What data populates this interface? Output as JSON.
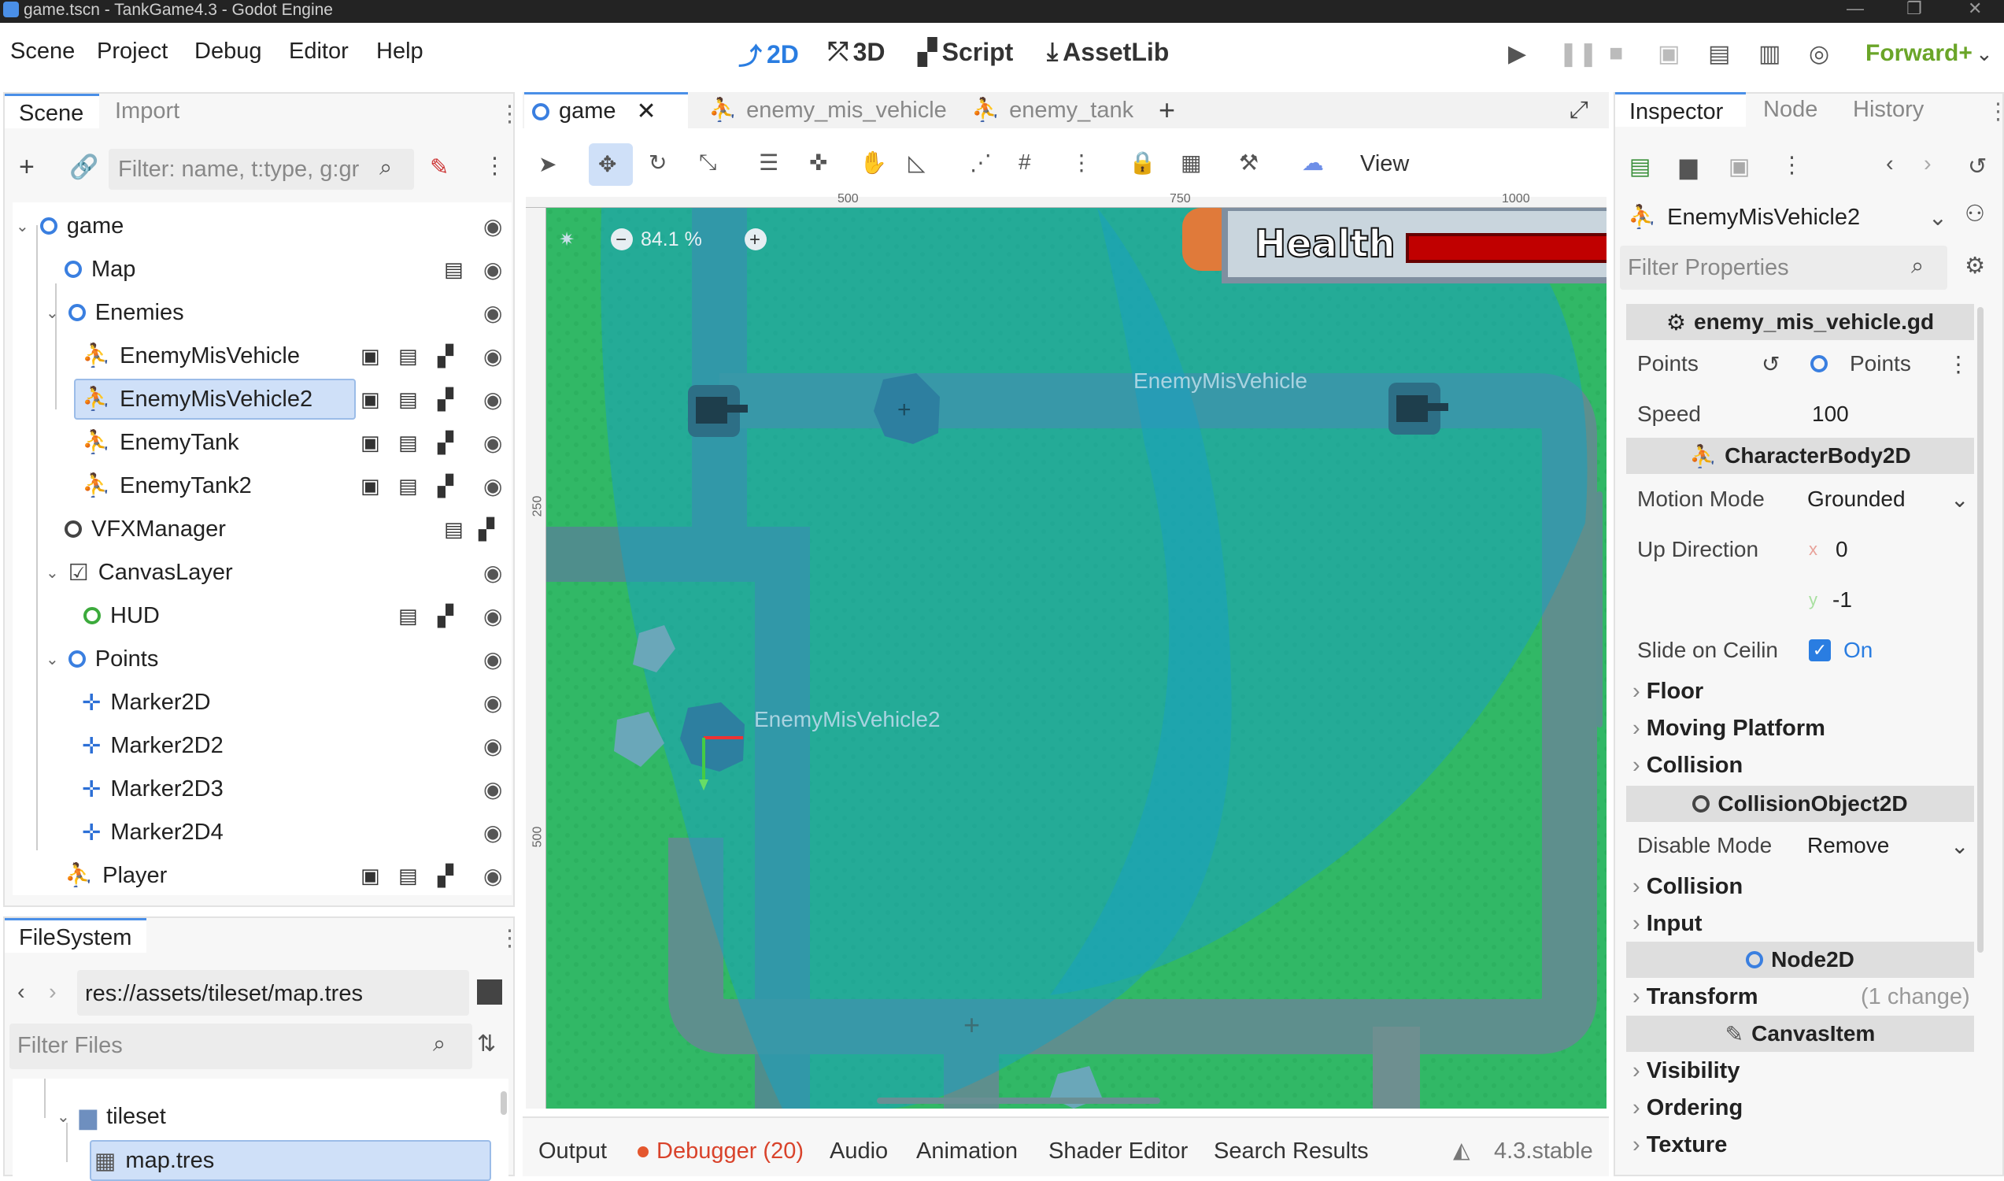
{
  "window": {
    "title": "game.tscn - TankGame4.3 - Godot Engine"
  },
  "menu": {
    "items": [
      "Scene",
      "Project",
      "Debug",
      "Editor",
      "Help"
    ]
  },
  "workspaces": {
    "2d": "2D",
    "3d": "3D",
    "script": "Script",
    "assetlib": "AssetLib"
  },
  "renderer": "Forward+",
  "scene_dock": {
    "tabs": [
      "Scene",
      "Import"
    ],
    "filter_placeholder": "Filter: name, t:type, g:gr",
    "tree": [
      {
        "label": "game"
      },
      {
        "label": "Map"
      },
      {
        "label": "Enemies"
      },
      {
        "label": "EnemyMisVehicle"
      },
      {
        "label": "EnemyMisVehicle2"
      },
      {
        "label": "EnemyTank"
      },
      {
        "label": "EnemyTank2"
      },
      {
        "label": "VFXManager"
      },
      {
        "label": "CanvasLayer"
      },
      {
        "label": "HUD"
      },
      {
        "label": "Points"
      },
      {
        "label": "Marker2D"
      },
      {
        "label": "Marker2D2"
      },
      {
        "label": "Marker2D3"
      },
      {
        "label": "Marker2D4"
      },
      {
        "label": "Player"
      }
    ]
  },
  "filesystem": {
    "tab": "FileSystem",
    "path": "res://assets/tileset/map.tres",
    "filter_placeholder": "Filter Files",
    "items": [
      {
        "label": "tileset"
      },
      {
        "label": "map.tres"
      }
    ]
  },
  "editor_tabs": [
    {
      "label": "game"
    },
    {
      "label": "enemy_mis_vehicle"
    },
    {
      "label": "enemy_tank"
    }
  ],
  "viewport": {
    "zoom": "84.1 %",
    "view_menu": "View",
    "ruler_ticks": [
      "500",
      "750",
      "1000"
    ],
    "ruler_vticks": [
      "250",
      "500"
    ],
    "labels": {
      "mis1": "EnemyMisVehicle",
      "mis2": "EnemyMisVehicle2"
    },
    "hud_health": "Health"
  },
  "bottom_panel": {
    "tabs": [
      "Output",
      "Debugger (20)",
      "Audio",
      "Animation",
      "Shader Editor",
      "Search Results"
    ],
    "version": "4.3.stable"
  },
  "inspector": {
    "tabs": [
      "Inspector",
      "Node",
      "History"
    ],
    "node": "EnemyMisVehicle2",
    "filter_placeholder": "Filter Properties",
    "script": "enemy_mis_vehicle.gd",
    "points_label": "Points",
    "points_value": "Points",
    "speed_label": "Speed",
    "speed_value": "100",
    "class1": "CharacterBody2D",
    "motion_mode_label": "Motion Mode",
    "motion_mode_value": "Grounded",
    "up_dir_label": "Up Direction",
    "up_x": "0",
    "up_y": "-1",
    "x": "x",
    "y": "y",
    "slide_label": "Slide on Ceilin",
    "slide_value": "On",
    "sections1": [
      "Floor",
      "Moving Platform",
      "Collision"
    ],
    "class2": "CollisionObject2D",
    "disable_label": "Disable Mode",
    "disable_value": "Remove",
    "sections2": [
      "Collision",
      "Input"
    ],
    "class3": "Node2D",
    "transform": "Transform",
    "transform_note": "(1 change)",
    "class4": "CanvasItem",
    "sections3": [
      "Visibility",
      "Ordering",
      "Texture"
    ]
  }
}
